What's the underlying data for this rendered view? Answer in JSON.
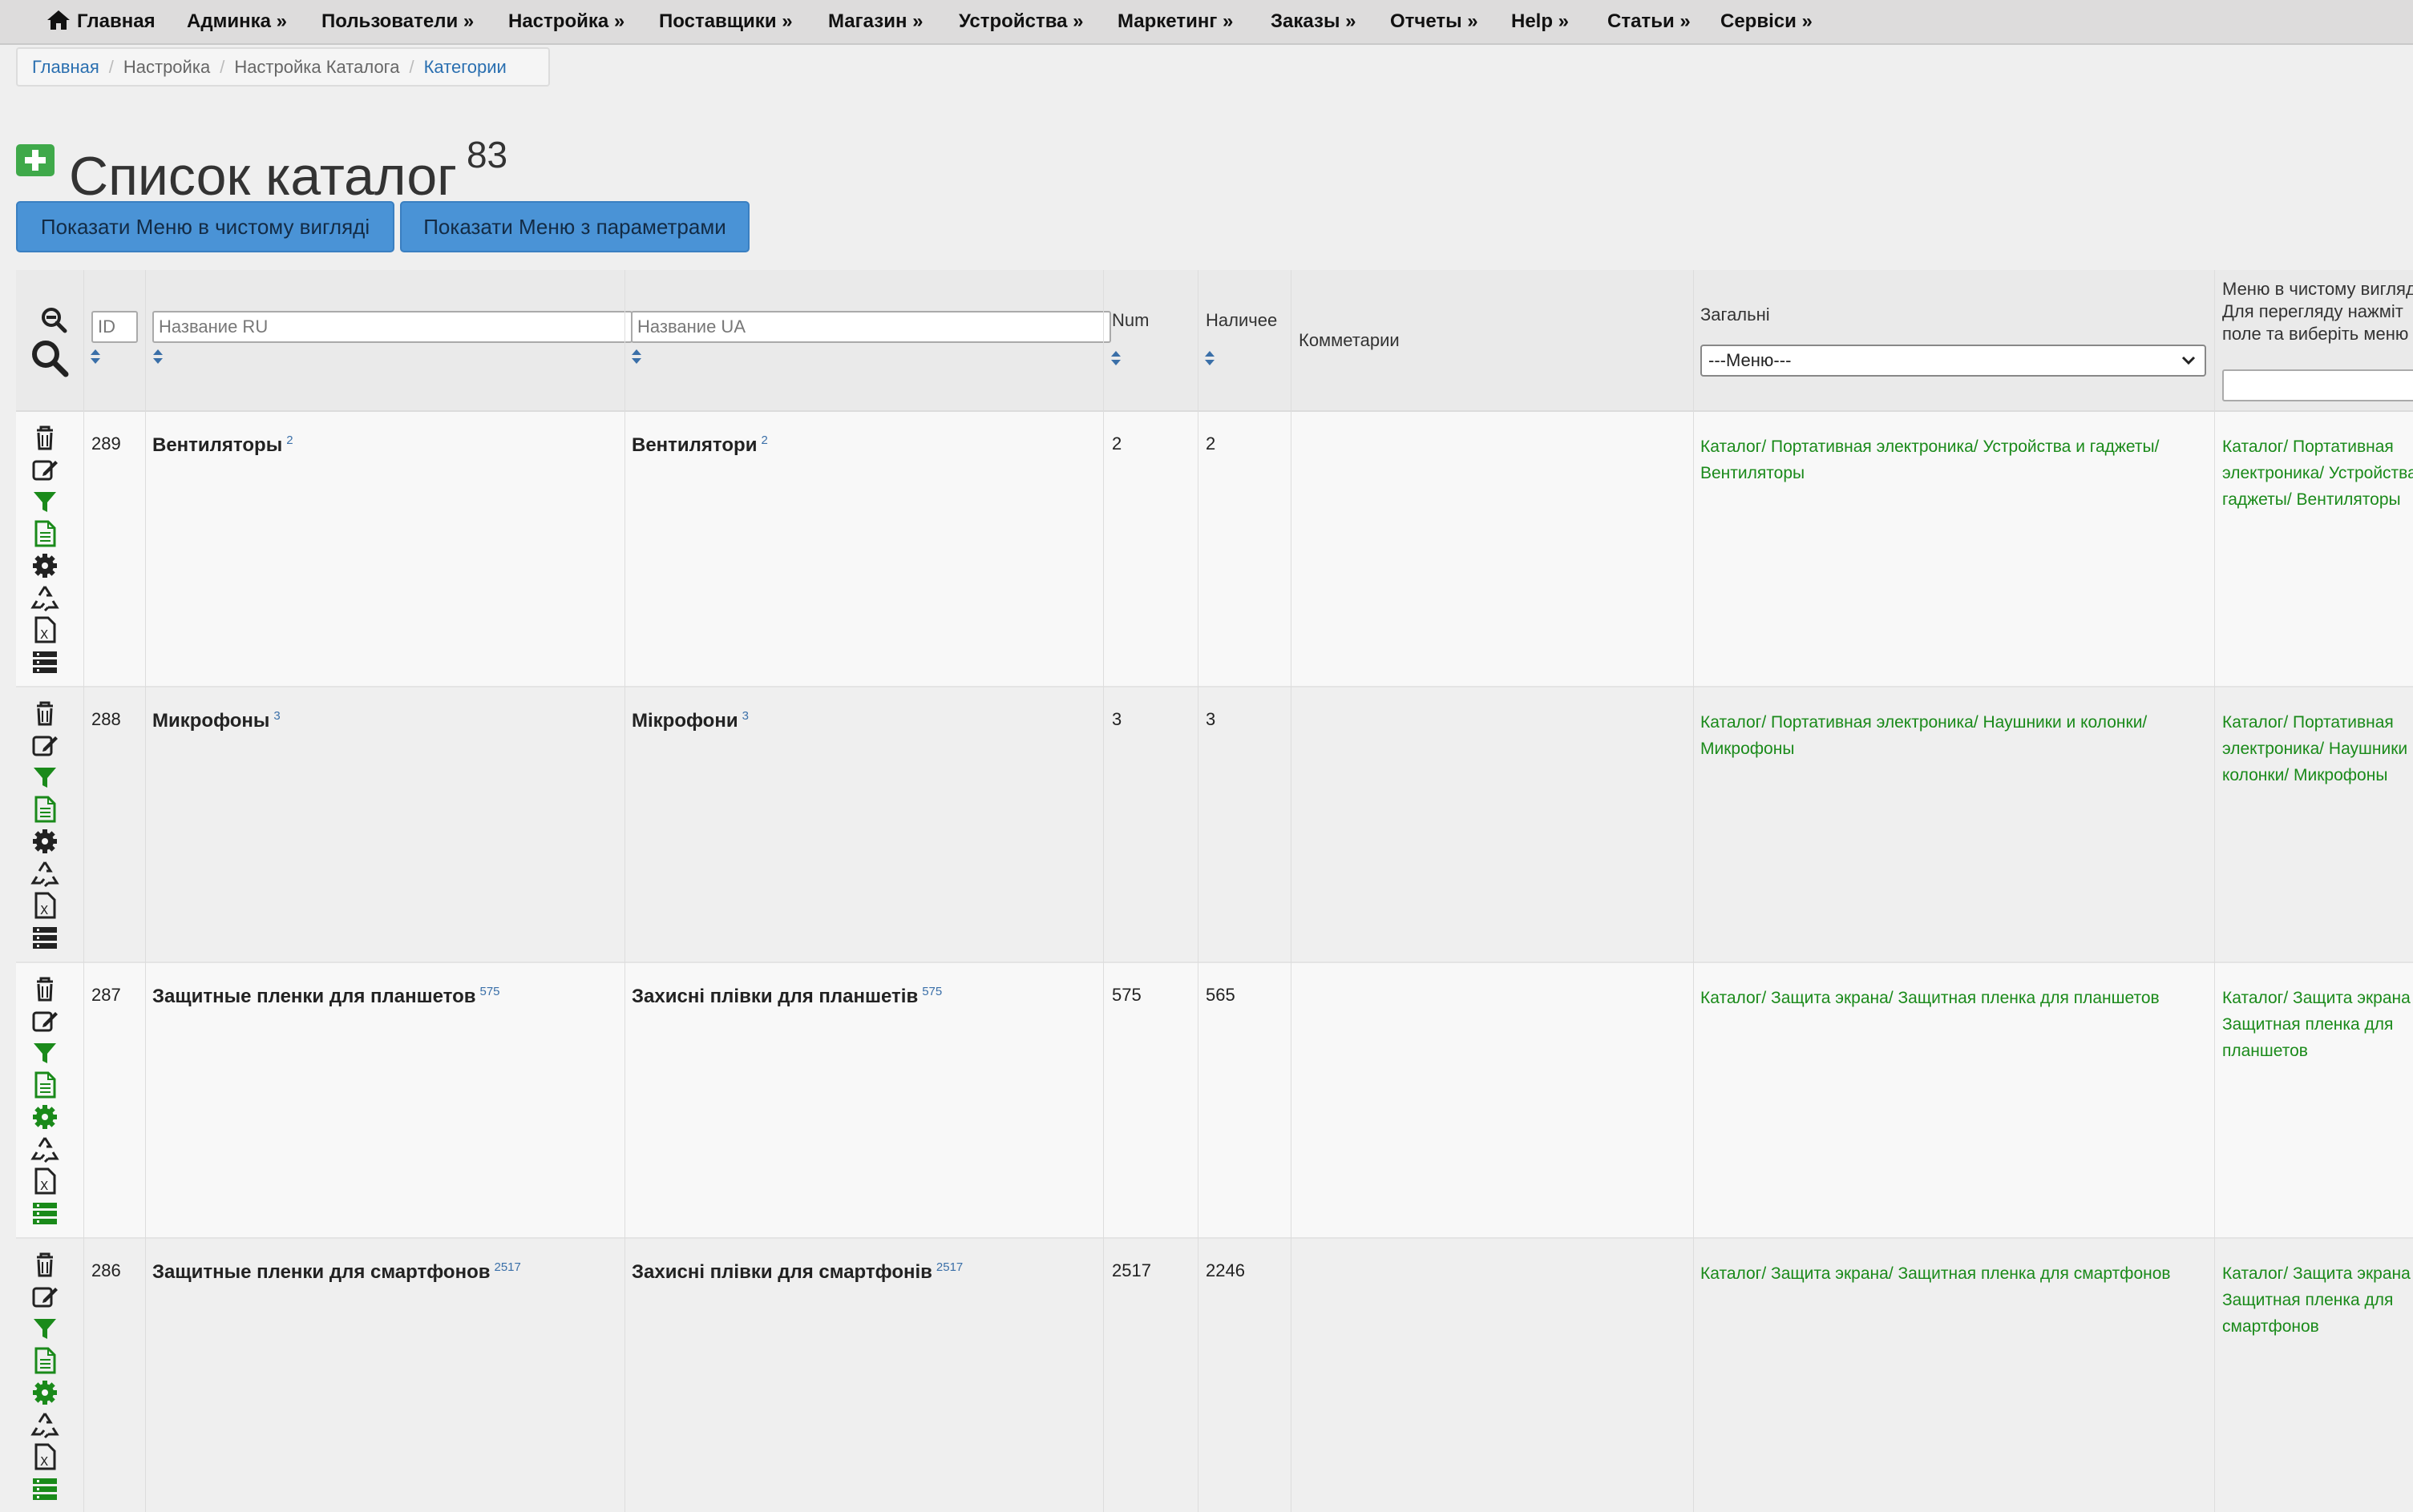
{
  "nav": {
    "home": "Главная",
    "items": [
      "Админка »",
      "Пользователи »",
      "Настройка »",
      "Поставщики »",
      "Магазин »",
      "Устройства »",
      "Маркетинг »",
      "Заказы »",
      "Отчеты »",
      "Help »",
      "Статьи »",
      "Сервіси »"
    ]
  },
  "breadcrumb": [
    "Главная",
    "Настройка",
    "Настройка Каталога",
    "Категории"
  ],
  "title": "Список каталог",
  "title_count": "83",
  "buttons": {
    "show_clean": "Показати Меню в чистому вигляді",
    "show_params": "Показати Меню з параметрами"
  },
  "header": {
    "id_placeholder": "ID",
    "name_ru_placeholder": "Название RU",
    "name_ua_placeholder": "Название UA",
    "num": "Num",
    "stock": "Наличее",
    "comments": "Комметарии",
    "general": "Загальні",
    "menu_select": "---Меню---",
    "menu_clean_line1": "Меню в чистому вигляд",
    "menu_clean_line2": "Для перегляду нажміт",
    "menu_clean_line3": "поле та виберіть меню"
  },
  "rows": [
    {
      "id": "289",
      "name_ru": "Вентиляторы",
      "sup_ru": "2",
      "name_ua": "Вентилятори",
      "sup_ua": "2",
      "num": "2",
      "stock": "2",
      "path1": "Каталог/ Портативная электроника/ Устройства и гаджеты/",
      "path2": "Вентиляторы",
      "menu1": "Каталог/ Портативная",
      "menu2": "электроника/ Устройства",
      "menu3": "гаджеты/ Вентиляторы"
    },
    {
      "id": "288",
      "name_ru": "Микрофоны",
      "sup_ru": "3",
      "name_ua": "Мікрофони",
      "sup_ua": "3",
      "num": "3",
      "stock": "3",
      "path1": "Каталог/ Портативная электроника/ Наушники и колонки/",
      "path2": "Микрофоны",
      "menu1": "Каталог/ Портативная",
      "menu2": "электроника/ Наушники",
      "menu3": "колонки/ Микрофоны"
    },
    {
      "id": "287",
      "name_ru": "Защитные пленки для планшетов",
      "sup_ru": "575",
      "name_ua": "Захисні плівки для планшетів",
      "sup_ua": "575",
      "num": "575",
      "stock": "565",
      "path1": "Каталог/ Защита экрана/ Защитная пленка для планшетов",
      "path2": "",
      "menu1": "Каталог/ Защита экрана",
      "menu2": "Защитная пленка для",
      "menu3": "планшетов"
    },
    {
      "id": "286",
      "name_ru": "Защитные пленки для смартфонов",
      "sup_ru": "2517",
      "name_ua": "Захисні плівки для смартфонів",
      "sup_ua": "2517",
      "num": "2517",
      "stock": "2246",
      "path1": "Каталог/ Защита экрана/ Защитная пленка для смартфонов",
      "path2": "",
      "menu1": "Каталог/ Защита экрана",
      "menu2": "Защитная пленка для",
      "menu3": "смартфонов"
    }
  ],
  "colors": {
    "nav_bg": "#dddcdc",
    "button": "#4a93d6",
    "path_green": "#1a8a1a",
    "link_blue": "#2a6fb0",
    "add_green": "#3fa94a"
  }
}
